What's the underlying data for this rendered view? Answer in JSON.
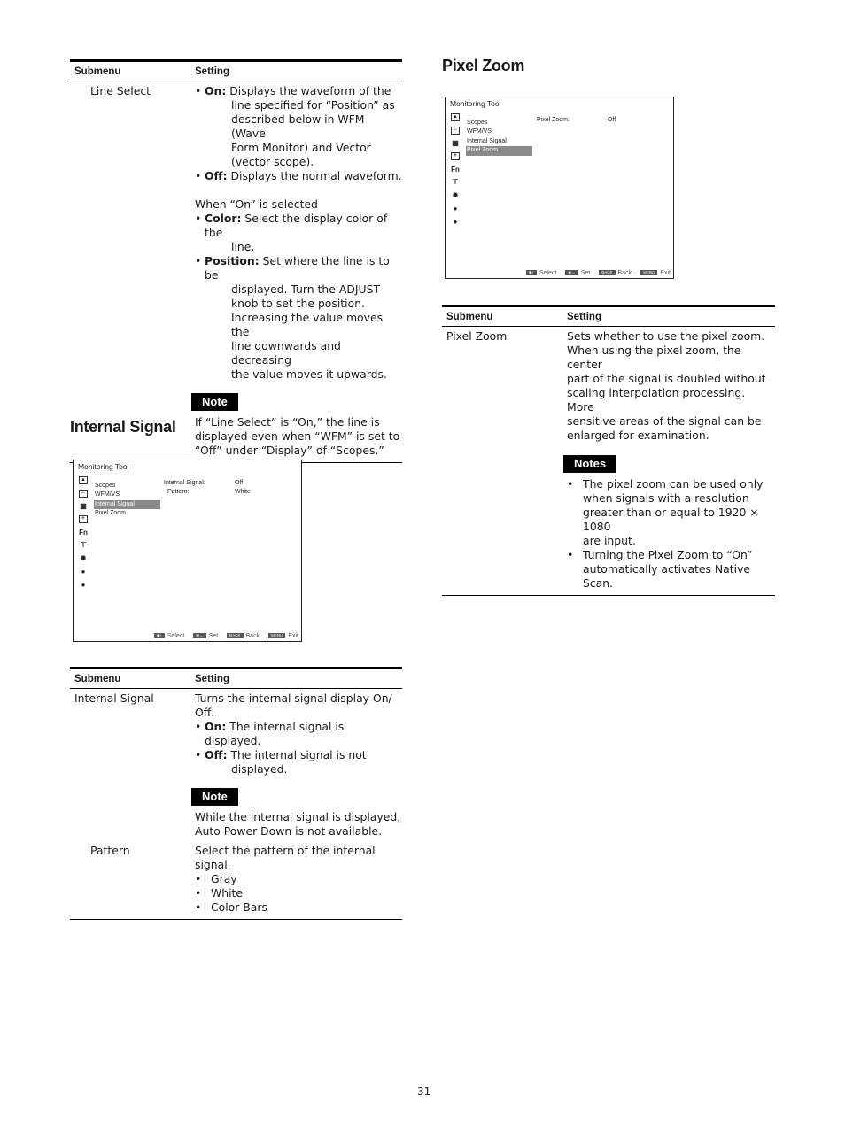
{
  "table_line_select": {
    "headers": {
      "submenu": "Submenu",
      "setting": "Setting"
    },
    "row": {
      "submenu": "Line Select",
      "on_label": "On:",
      "on_text_first": "Displays the waveform of the",
      "on_text_rest": [
        "line specified for “Position” as",
        "described below in WFM (Wave",
        "Form Monitor) and Vector",
        "(vector scope)."
      ],
      "off_label": "Off:",
      "off_text": "Displays the normal waveform.",
      "when_on": "When “On” is selected",
      "color_label": "Color:",
      "color_text_first": "Select the display color of the",
      "color_text_rest": [
        "line."
      ],
      "position_label": "Position:",
      "position_text_first": "Set where the line is to be",
      "position_text_rest": [
        "displayed. Turn the ADJUST",
        "knob to set the position.",
        "Increasing the value moves the",
        "line downwards and decreasing",
        "the value moves it upwards."
      ],
      "note_label": "Note",
      "note_text": [
        "If “Line Select” is “On,” the line is",
        "displayed even when “WFM” is set to",
        "“Off” under “Display” of “Scopes.”"
      ]
    }
  },
  "section_internal_signal": {
    "heading": "Internal Signal",
    "screen": {
      "title": "Monitoring Tool",
      "icons": [
        "person-icon",
        "waveform-icon",
        "grid-icon",
        "input-icon",
        "fn-icon",
        "display-icon",
        "gear-icon",
        "wrench-icon",
        "info-icon"
      ],
      "fn_label": "Fn",
      "menu": [
        "Scopes",
        "WFM/VS",
        "Internal Signal",
        "Pixel Zoom"
      ],
      "selected_index": 2,
      "params": [
        {
          "label": "Internal Signal:",
          "value": "Off"
        },
        {
          "label": "Pattern:",
          "value": "White"
        }
      ],
      "footer": [
        {
          "key": "◉↕",
          "label": "Select"
        },
        {
          "key": "◉←",
          "label": "Set"
        },
        {
          "key": "BACK",
          "label": "Back"
        },
        {
          "key": "MENU",
          "label": "Exit"
        }
      ]
    },
    "table": {
      "headers": {
        "submenu": "Submenu",
        "setting": "Setting"
      },
      "row1": {
        "submenu": "Internal Signal",
        "desc": [
          "Turns the internal signal display On/",
          "Off."
        ],
        "on_label": "On:",
        "on_text": "The internal signal is displayed.",
        "off_label": "Off:",
        "off_text_first": "The internal signal is not",
        "off_text_rest": [
          "displayed."
        ],
        "note_label": "Note",
        "note_text": [
          "While the internal signal is displayed,",
          "Auto Power Down is not available."
        ]
      },
      "row2": {
        "submenu": "Pattern",
        "desc": [
          "Select the pattern of the internal",
          "signal."
        ],
        "options": [
          "Gray",
          "White",
          "Color Bars"
        ]
      }
    }
  },
  "section_pixel_zoom": {
    "heading": "Pixel Zoom",
    "screen": {
      "title": "Monitoring Tool",
      "fn_label": "Fn",
      "menu": [
        "Scopes",
        "WFM/VS",
        "Internal Signal",
        "Pixel Zoom"
      ],
      "selected_index": 3,
      "params": [
        {
          "label": "Pixel Zoom:",
          "value": "Off"
        }
      ],
      "footer": [
        {
          "key": "◉↕",
          "label": "Select"
        },
        {
          "key": "◉←",
          "label": "Set"
        },
        {
          "key": "BACK",
          "label": "Back"
        },
        {
          "key": "MENU",
          "label": "Exit"
        }
      ]
    },
    "table": {
      "headers": {
        "submenu": "Submenu",
        "setting": "Setting"
      },
      "row": {
        "submenu": "Pixel Zoom",
        "desc": [
          "Sets whether to use the pixel zoom.",
          "When using the pixel zoom, the center",
          "part of the signal is doubled without",
          "scaling interpolation processing. More",
          "sensitive areas of the signal can be",
          "enlarged for examination."
        ],
        "notes_label": "Notes",
        "notes": [
          [
            "The pixel zoom can be used only",
            "when signals with a resolution",
            "greater than or equal to 1920 × 1080",
            "are input."
          ],
          [
            "Turning the Pixel Zoom to “On”",
            "automatically activates Native Scan."
          ]
        ]
      }
    }
  },
  "page_number": "31"
}
